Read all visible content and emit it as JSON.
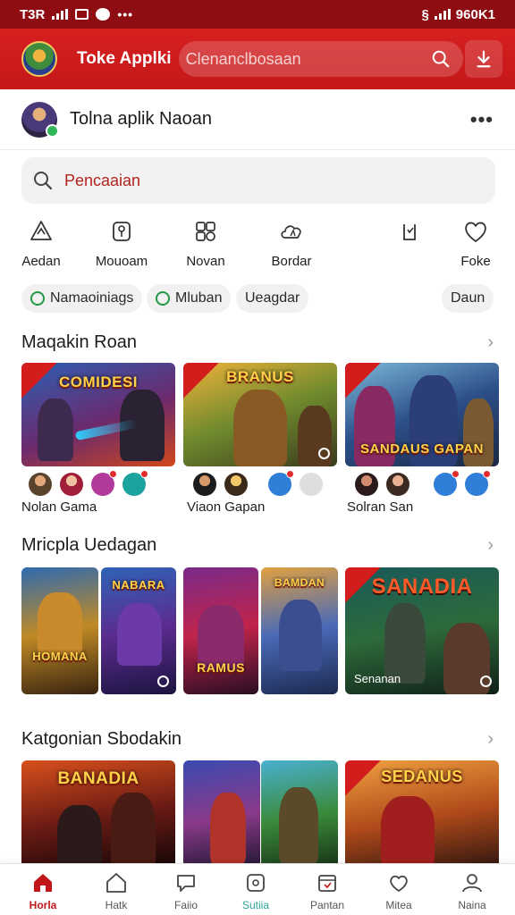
{
  "status_bar": {
    "time": "T3R",
    "right_text": "960K1"
  },
  "app_bar": {
    "title": "Toke Applki",
    "search_placeholder": "Clenanclbosaan"
  },
  "profile": {
    "name": "Tolna aplik Naoan"
  },
  "search": {
    "placeholder": "Pencaaian"
  },
  "quick_actions": [
    {
      "label": "Aedan",
      "icon": "triangle-recycle-icon"
    },
    {
      "label": "Mouoam",
      "icon": "cup-icon"
    },
    {
      "label": "Novan",
      "icon": "puzzle-icon"
    },
    {
      "label": "Bordar",
      "icon": "cloud-icon"
    },
    {
      "label": "",
      "icon": "bookmark-icon"
    },
    {
      "label": "Foke",
      "icon": "heart-icon"
    }
  ],
  "chips": [
    {
      "label": "Namaoiniags"
    },
    {
      "label": "Mluban"
    },
    {
      "label": "Ueagdar"
    },
    {
      "label": "Daun"
    }
  ],
  "sections": [
    {
      "title": "Maqakin Roan",
      "cards": [
        {
          "title": "COMIDESI",
          "label": "Nolan Gama"
        },
        {
          "title": "BRANUS",
          "label": "Viaon Gapan"
        },
        {
          "title": "SANDAUS GAPAN",
          "label": "Solran San"
        }
      ]
    },
    {
      "title": "Mricpla Uedagan",
      "cards": [
        {
          "title": "HOMANA"
        },
        {
          "title": "NABARA"
        },
        {
          "title": "RAMUS"
        },
        {
          "title": "BAMDAN"
        },
        {
          "title": "SANADIA",
          "sub": "Senanan"
        }
      ]
    },
    {
      "title": "Katgonian Sbodakin",
      "cards": [
        {
          "title": "BANADIA"
        },
        {
          "title": ""
        },
        {
          "title": ""
        },
        {
          "title": "SEDANUS"
        }
      ]
    }
  ],
  "bottom_nav": [
    {
      "label": "Horla",
      "icon": "home-icon",
      "active": true
    },
    {
      "label": "Hatk",
      "icon": "house-outline-icon"
    },
    {
      "label": "Faiio",
      "icon": "chat-heart-icon"
    },
    {
      "label": "Sutiia",
      "icon": "square-icon"
    },
    {
      "label": "Pantan",
      "icon": "calendar-icon"
    },
    {
      "label": "Mitea",
      "icon": "heart-chat-icon"
    },
    {
      "label": "Naina",
      "icon": "person-icon"
    }
  ],
  "colors": {
    "brand": "#c9161c",
    "brand_dark": "#8e0d12",
    "active_nav": "#c1161a",
    "chip_icon": "#1f9a48"
  }
}
